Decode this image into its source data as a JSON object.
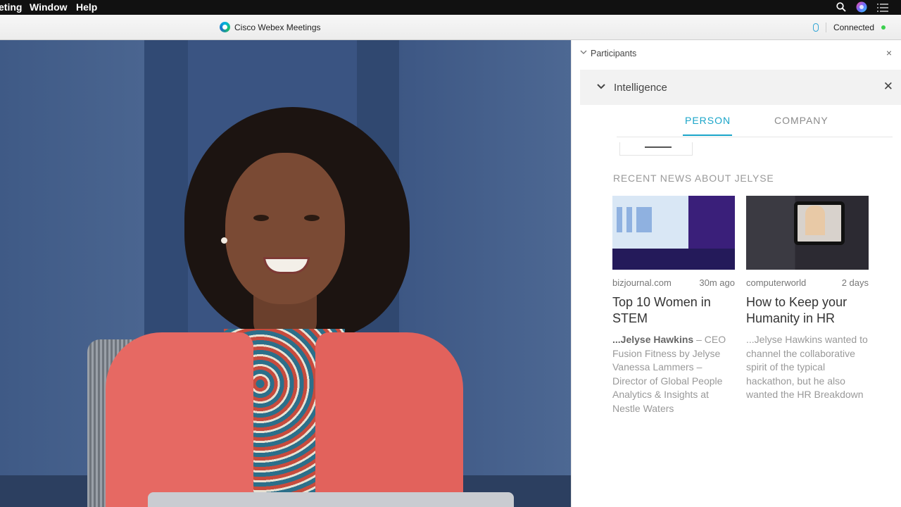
{
  "menubar": {
    "items": [
      "eting",
      "Window",
      "Help"
    ]
  },
  "titlebar": {
    "app_title": "Cisco Webex Meetings",
    "status": "Connected"
  },
  "side_panel": {
    "participants_label": "Participants",
    "close_symbol": "×",
    "intelligence": {
      "label": "Intelligence",
      "close_symbol": "✕"
    },
    "tabs": [
      {
        "label": "PERSON",
        "active": true
      },
      {
        "label": "COMPANY",
        "active": false
      }
    ],
    "news_heading": "RECENT NEWS ABOUT JELYSE",
    "news": [
      {
        "source": "bizjournal.com",
        "time": "30m ago",
        "headline": "Top 10 Women in STEM",
        "snippet_bold": "...Jelyse Hawkins",
        "snippet_rest": " – CEO Fusion Fitness by Jelyse Vanessa Lammers – Director of Global People Analytics & Insights at Nestle Waters"
      },
      {
        "source": "computerworld",
        "time": "2 days",
        "headline": "How to Keep your Humanity in HR",
        "snippet_bold": "",
        "snippet_rest": "...Jelyse Hawkins wanted to channel the collaborative spirit of the typical hackathon, but he also wanted the HR Breakdown"
      }
    ]
  },
  "colors": {
    "accent": "#1aa5c9",
    "connected_dot": "#3ccf4e"
  },
  "icons": [
    "search-icon",
    "siri-icon",
    "notification-list-icon",
    "webex-logo-icon",
    "microphone-icon",
    "chevron-down-icon",
    "close-icon"
  ]
}
